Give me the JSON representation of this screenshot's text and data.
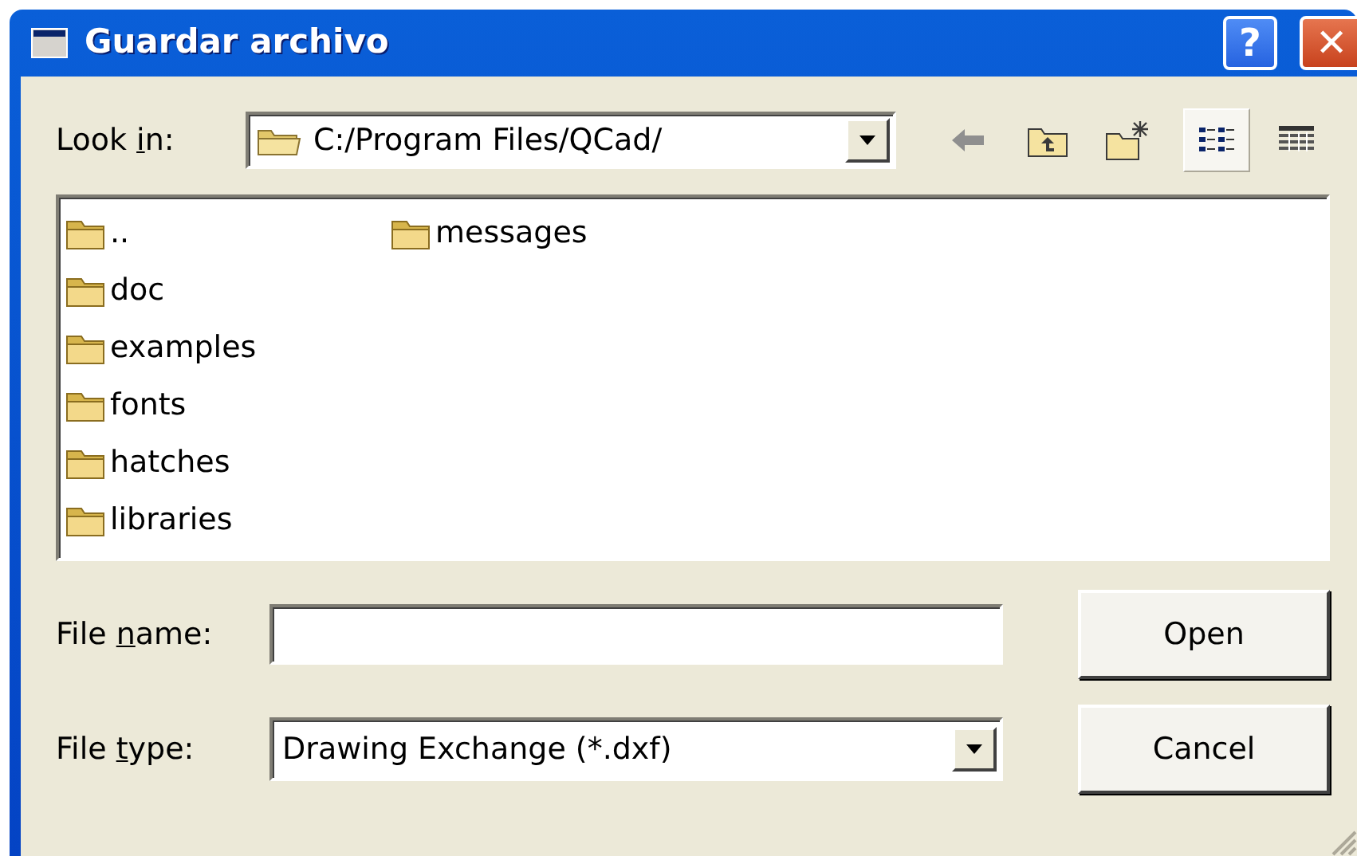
{
  "window": {
    "title": "Guardar archivo",
    "help_button": "?",
    "close_button": "✕"
  },
  "look_in": {
    "label_parts": [
      "Look ",
      "i",
      "n:"
    ],
    "value": "C:/Program Files/QCad/"
  },
  "nav_buttons": [
    {
      "kind": "back",
      "disabled": true
    },
    {
      "kind": "up",
      "disabled": false
    },
    {
      "kind": "new-folder",
      "disabled": false
    }
  ],
  "view_modes": [
    {
      "kind": "list",
      "selected": true
    },
    {
      "kind": "detail",
      "selected": false
    }
  ],
  "files": [
    {
      "name": ".."
    },
    {
      "name": "doc"
    },
    {
      "name": "examples"
    },
    {
      "name": "fonts"
    },
    {
      "name": "hatches"
    },
    {
      "name": "libraries"
    },
    {
      "name": "messages"
    }
  ],
  "file_name": {
    "label_parts": [
      "File ",
      "n",
      "ame:"
    ]
  },
  "file_type": {
    "label_parts": [
      "File ",
      "t",
      "ype:"
    ],
    "value": "Drawing Exchange (*.dxf)"
  },
  "buttons": [
    {
      "label": "Open"
    },
    {
      "label": "Cancel"
    }
  ]
}
